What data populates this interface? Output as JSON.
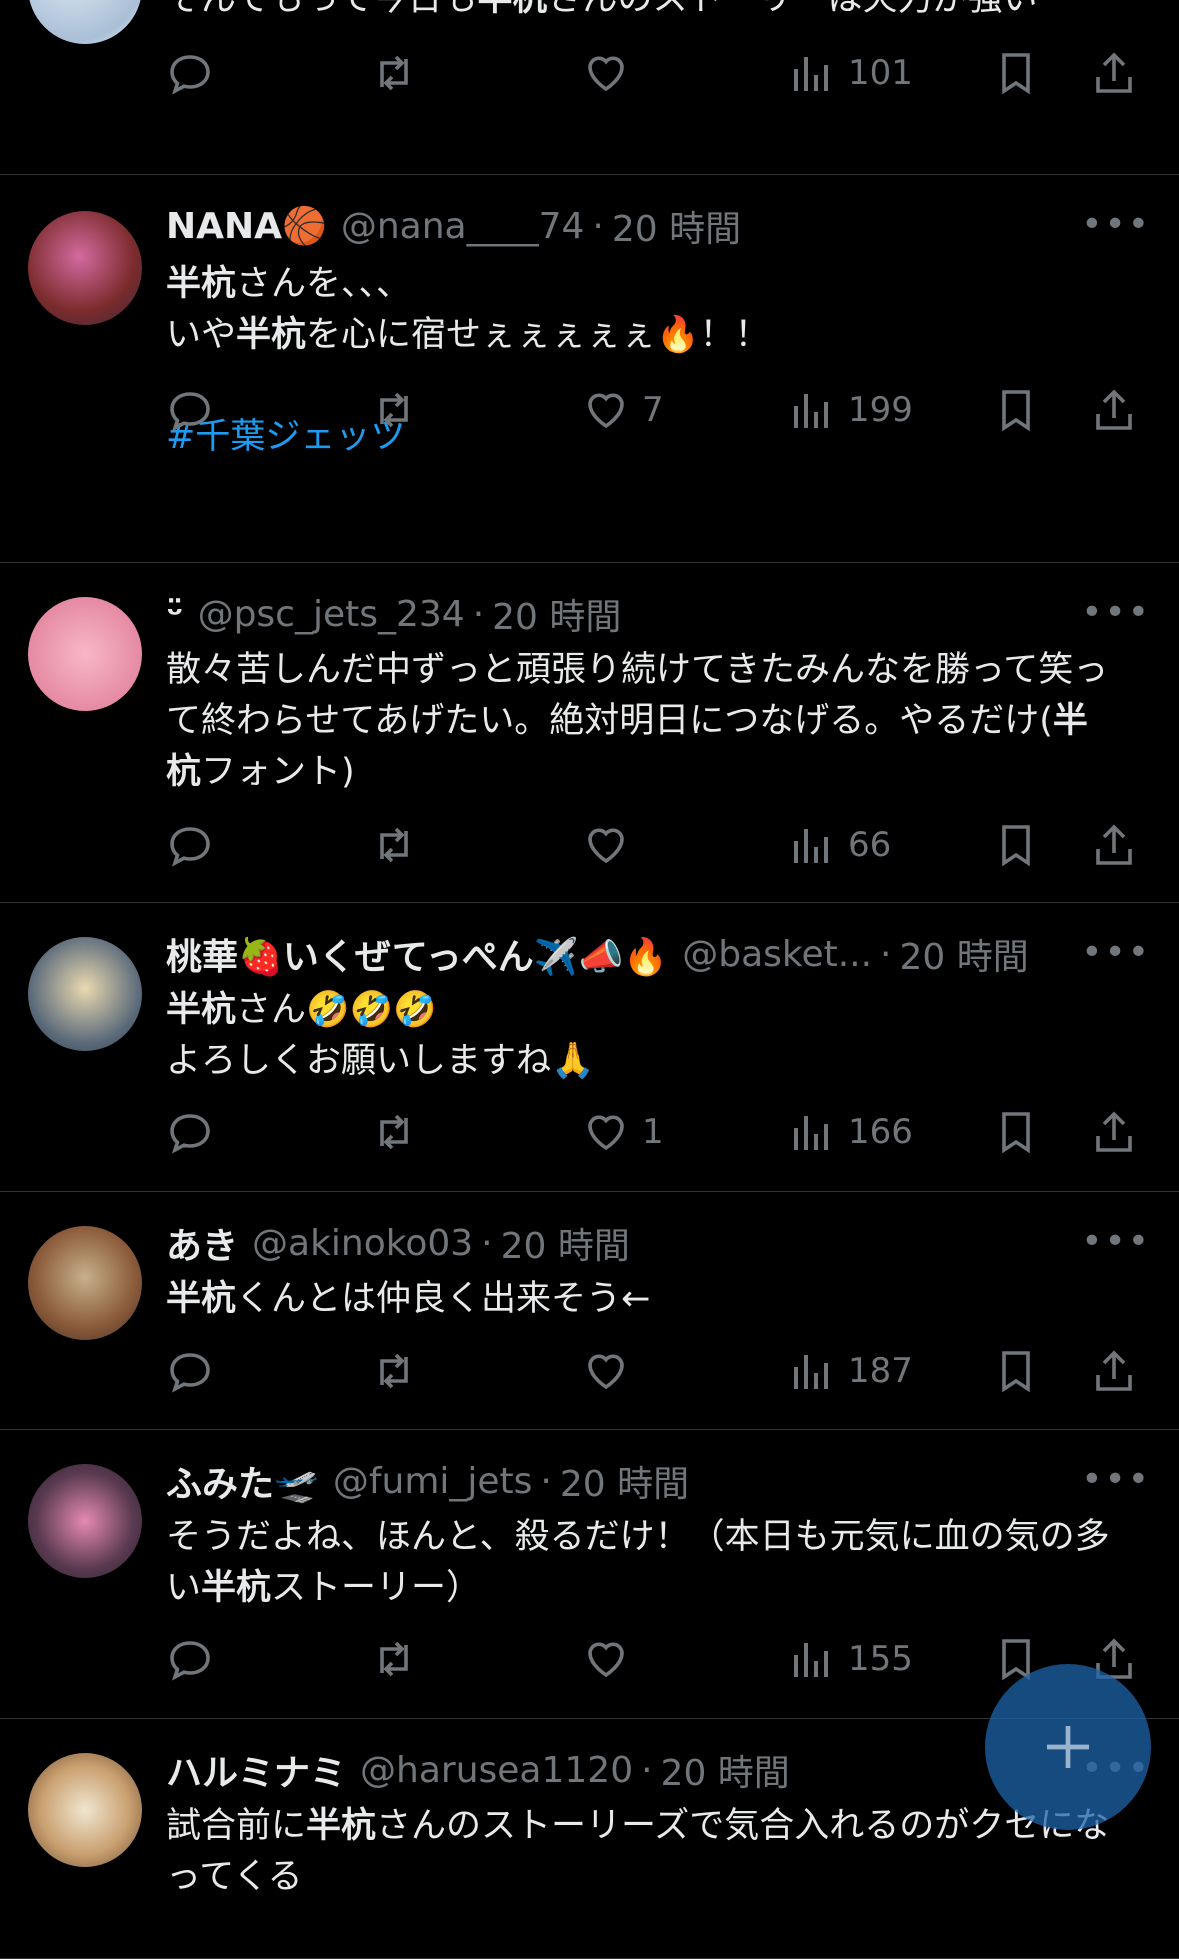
{
  "tweets": [
    {
      "display_name": "",
      "handle": "",
      "time": "",
      "lines": [
        "そんでもって今日も<b>半杭</b>さんのストーリーは火力が強い"
      ],
      "replies": "",
      "retweets": "",
      "likes": "",
      "views": "101"
    },
    {
      "display_name": "NANA🏀",
      "handle": "@nana____74",
      "time": "20 時間",
      "lines": [
        "<b>半杭</b>さんを、、、",
        "いや<b>半杭</b>を心に宿せぇぇぇぇぇ🔥！！",
        "",
        "<span class='tag'>#千葉ジェッツ</span>"
      ],
      "replies": "",
      "retweets": "",
      "likes": "7",
      "views": "199"
    },
    {
      "display_name": "ᵕ̈",
      "handle": "@psc_jets_234",
      "time": "20 時間",
      "lines": [
        "散々苦しんだ中ずっと頑張り続けてきたみんなを勝って笑っ",
        "て終わらせてあげたい。絶対明日につなげる。やるだけ(<b>半</b>",
        "<b>杭</b>フォント)"
      ],
      "replies": "",
      "retweets": "",
      "likes": "",
      "views": "66"
    },
    {
      "display_name": "桃華🍓いくぜてっぺん✈️📣🔥",
      "handle": "@basket...",
      "time": "20 時間",
      "lines": [
        "<b>半杭</b>さん🤣🤣🤣",
        "よろしくお願いしますね🙏"
      ],
      "replies": "",
      "retweets": "",
      "likes": "1",
      "views": "166"
    },
    {
      "display_name": "あき",
      "handle": "@akinoko03",
      "time": "20 時間",
      "lines": [
        "<b>半杭</b>くんとは仲良く出来そう←"
      ],
      "replies": "",
      "retweets": "",
      "likes": "",
      "views": "187"
    },
    {
      "display_name": "ふみた🛫",
      "handle": "@fumi_jets",
      "time": "20 時間",
      "lines": [
        "そうだよね、ほんと、殺るだけ！（本日も元気に血の気の多",
        "い<b>半杭</b>ストーリー）"
      ],
      "replies": "",
      "retweets": "",
      "likes": "",
      "views": "155"
    },
    {
      "display_name": "ハルミナミ",
      "handle": "@harusea1120",
      "time": "20 時間",
      "lines": [
        "試合前に<b>半杭</b>さんのストーリーズで気合入れるのがクセにな",
        "ってくる"
      ],
      "replies": "",
      "retweets": "",
      "likes": "",
      "views": ""
    }
  ],
  "more_label": "•••",
  "colors": {
    "background": "#000000",
    "text": "#e7e9ea",
    "muted": "#71767b",
    "accent": "#1d9bf0"
  },
  "icons": {
    "reply": "reply-icon",
    "retweet": "retweet-icon",
    "like": "heart-icon",
    "views": "views-icon",
    "bookmark": "bookmark-icon",
    "share": "share-icon",
    "compose": "plus-icon"
  }
}
